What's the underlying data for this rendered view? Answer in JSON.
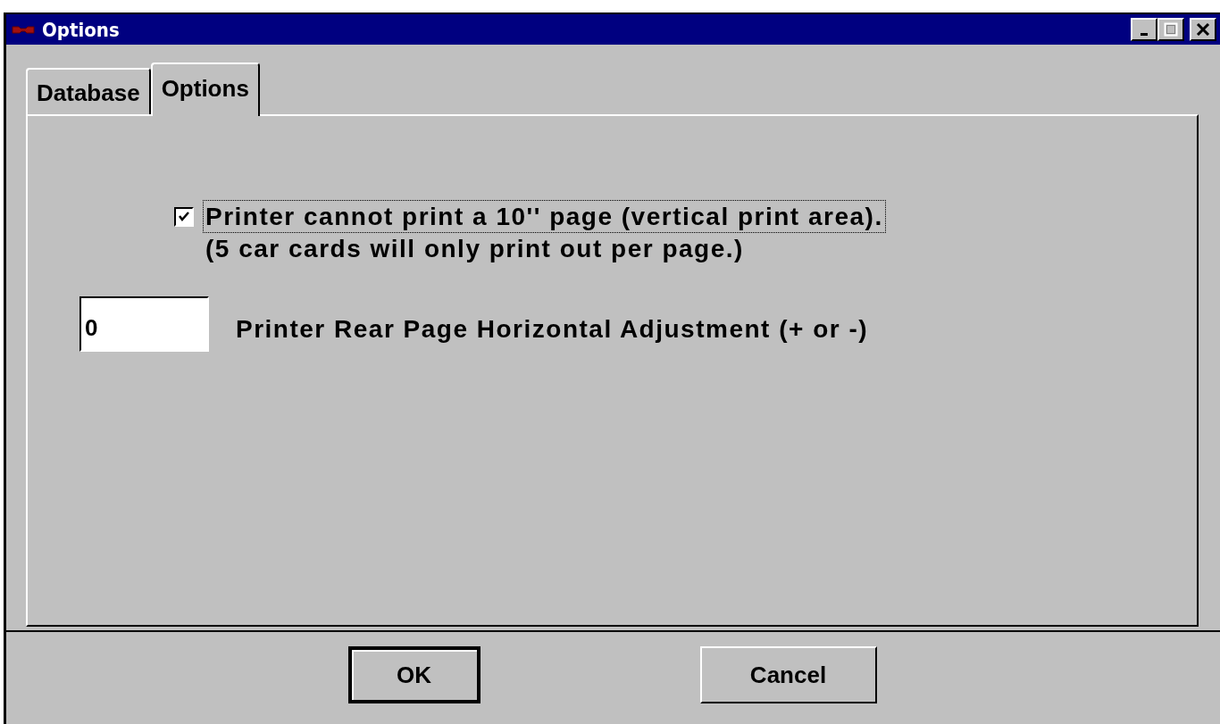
{
  "window": {
    "title": "Options"
  },
  "tabs": [
    {
      "label": "Database",
      "selected": false
    },
    {
      "label": "Options",
      "selected": true
    }
  ],
  "options_tab": {
    "checkbox": {
      "label": "Printer cannot print a 10'' page (vertical print area).",
      "note": "(5 car cards will only print out per page.)",
      "checked": true,
      "focused": true
    },
    "adjustment": {
      "value": "0",
      "label": "Printer Rear Page Horizontal Adjustment (+ or -)"
    }
  },
  "buttons": [
    {
      "label": "OK",
      "default": true
    },
    {
      "label": "Cancel",
      "default": false
    }
  ]
}
